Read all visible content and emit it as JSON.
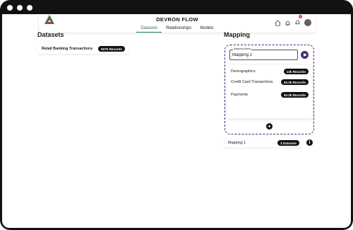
{
  "app": {
    "title": "DEVRON FLOW"
  },
  "nav": {
    "tabs": [
      {
        "label": "Datasets",
        "active": true
      },
      {
        "label": "Relationships",
        "active": false
      },
      {
        "label": "Models",
        "active": false
      }
    ]
  },
  "header_icons": [
    "home-icon",
    "bell-icon",
    "notification-icon",
    "avatar"
  ],
  "notification_count": "1",
  "datasets": {
    "heading": "Datasets",
    "items": [
      {
        "label": "Retail Banking Transactions",
        "records": "837k Records"
      }
    ]
  },
  "mapping": {
    "heading": "Mapping",
    "name_field": {
      "legend": "Mapping Name",
      "value": "Mapping 2"
    },
    "items": [
      {
        "label": "Demographics",
        "records": "13k Records"
      },
      {
        "label": "Credit Card Transactions",
        "records": "40.2k Records"
      },
      {
        "label": "Payments",
        "records": "40.2k Records"
      }
    ],
    "saved": [
      {
        "label": "Mapping 1",
        "datasets": "3 Datasets"
      }
    ]
  },
  "colors": {
    "accent_green": "#1f7a5c",
    "accent_purple": "#4a2a73",
    "pill": "#111111",
    "frame": "#121212"
  }
}
